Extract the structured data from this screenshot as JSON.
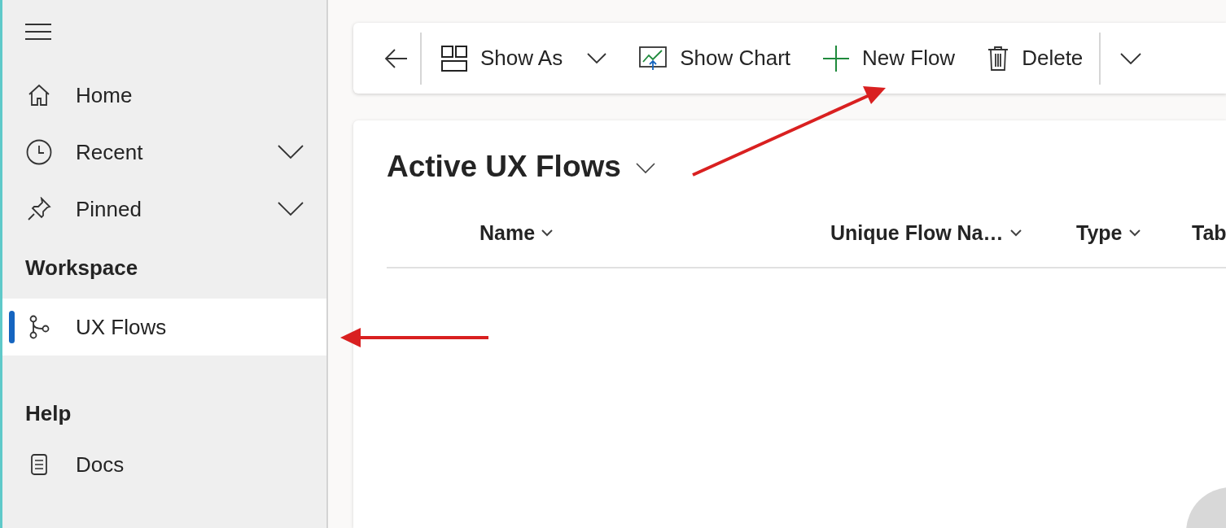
{
  "sidebar": {
    "nav_items": [
      {
        "label": "Home",
        "expandable": false
      },
      {
        "label": "Recent",
        "expandable": true
      },
      {
        "label": "Pinned",
        "expandable": true
      }
    ],
    "sections": [
      {
        "heading": "Workspace",
        "items": [
          {
            "label": "UX Flows",
            "selected": true
          }
        ]
      },
      {
        "heading": "Help",
        "items": [
          {
            "label": "Docs",
            "selected": false
          }
        ]
      }
    ]
  },
  "toolbar": {
    "buttons": [
      {
        "label": "Show As",
        "has_menu": true
      },
      {
        "label": "Show Chart",
        "has_menu": false
      },
      {
        "label": "New Flow",
        "has_menu": false
      },
      {
        "label": "Delete",
        "has_menu": false
      }
    ]
  },
  "view": {
    "title": "Active UX Flows"
  },
  "table": {
    "columns": [
      {
        "label": "Name",
        "has_menu": true
      },
      {
        "label": "Unique Flow Na…",
        "has_menu": true
      },
      {
        "label": "Type",
        "has_menu": true
      },
      {
        "label": "Tab"
      }
    ]
  }
}
